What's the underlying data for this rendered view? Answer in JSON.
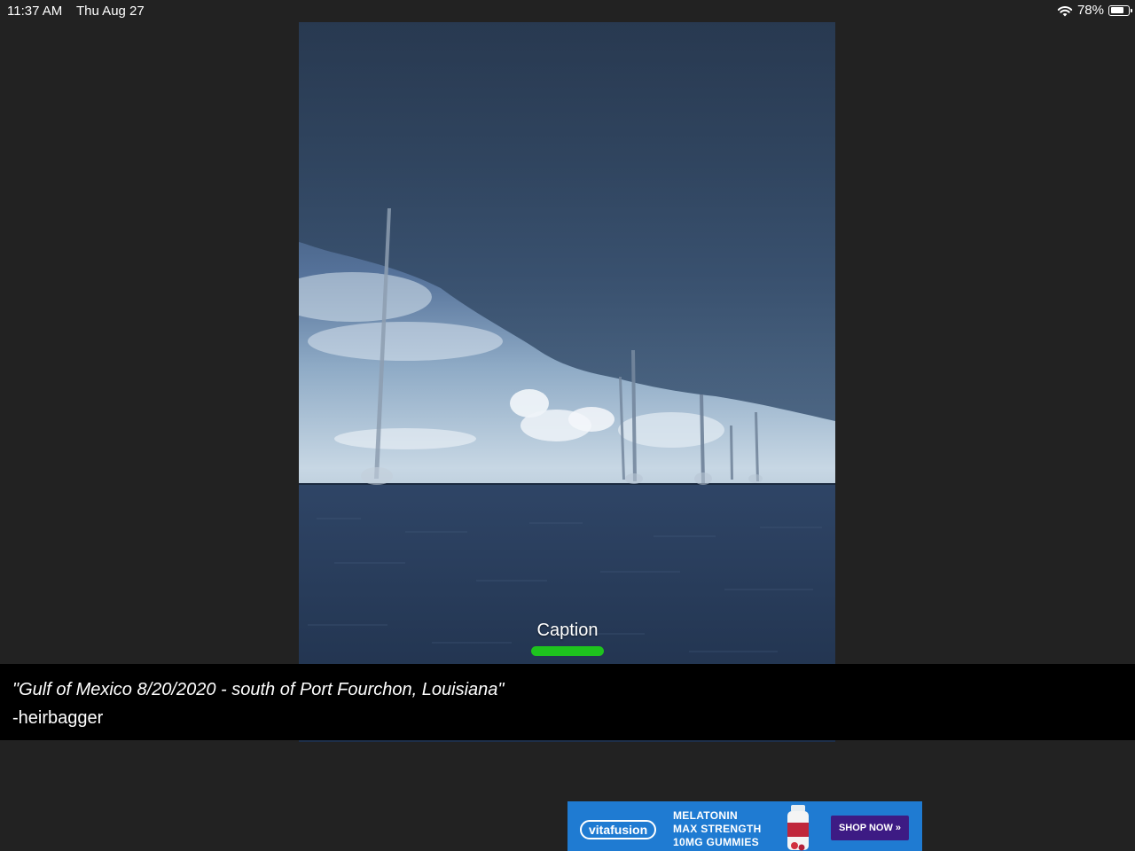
{
  "status_bar": {
    "time": "11:37 AM",
    "date": "Thu Aug 27",
    "battery_text": "78%",
    "battery_level": 0.78,
    "wifi_icon": "wifi-icon",
    "battery_icon": "battery-icon"
  },
  "photo": {
    "subject": "waterspouts over the sea"
  },
  "caption_button": {
    "label": "Caption",
    "handle_color": "#1ec31e"
  },
  "caption": {
    "quote": "\"Gulf of Mexico 8/20/2020 - south of Port Fourchon, Louisiana\"",
    "author": "-heirbagger"
  },
  "ad": {
    "brand": "vitafusion",
    "lines": [
      "MELATONIN",
      "MAX STRENGTH",
      "10MG GUMMIES"
    ],
    "cta": "SHOP NOW »",
    "colors": {
      "background": "#1f7bd2",
      "cta": "#3d1b84"
    }
  }
}
